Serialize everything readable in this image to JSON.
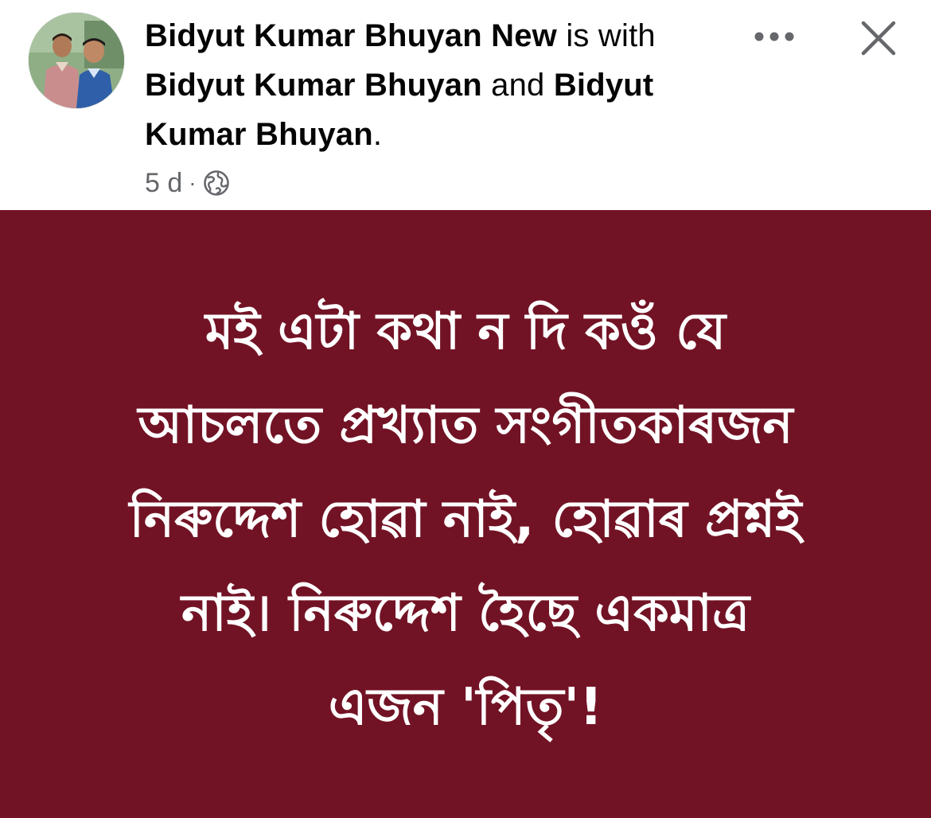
{
  "post": {
    "author": "Bidyut Kumar Bhuyan New",
    "with_text": " is with ",
    "tagged_1": "Bidyut Kumar Bhuyan",
    "and_text": " and ",
    "tagged_2": "Bidyut Kumar Bhuyan",
    "period": ".",
    "timestamp": "5 d",
    "separator": "·",
    "privacy_icon": "globe-icon",
    "more_icon": "more-options-icon",
    "close_icon": "close-icon",
    "body_background": "#721325",
    "body_lines": [
      "মই এটা কথা ন দি কওঁ যে",
      "আচলতে প্ৰখ্যাত সংগীতকাৰজন",
      "নিৰুদ্দেশ হোৱা নাই, হোৱাৰ প্ৰশ্নই",
      "নাই। নিৰুদ্দেশ হৈছে একমাত্ৰ",
      "এজন 'পিতৃ'!"
    ]
  }
}
